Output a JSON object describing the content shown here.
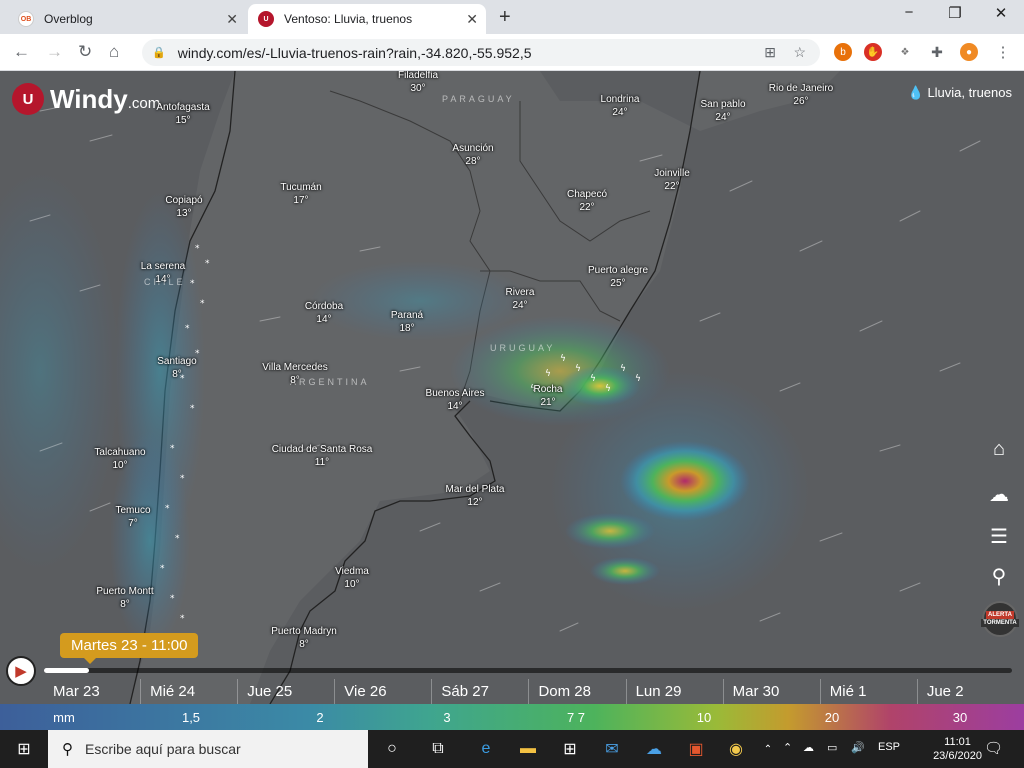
{
  "browser": {
    "tabs": [
      {
        "label": "Overblog",
        "favicon": "OB"
      },
      {
        "label": "Ventoso: Lluvia, truenos",
        "favicon": "windy-logo"
      }
    ],
    "new_tab": "+",
    "url": "windy.com/es/-Lluvia-truenos-rain?rain,-34.820,-55.952,5"
  },
  "map": {
    "logo_name": "Windy",
    "logo_domain": ".com",
    "layer_label": "Lluvia, truenos",
    "countries": [
      "PARAGUAY",
      "CHILE",
      "ARGENTINA",
      "URUGUAY"
    ],
    "cities": [
      {
        "name": "Filadelfia",
        "temp": "30°"
      },
      {
        "name": "Londrina",
        "temp": "24°"
      },
      {
        "name": "Rio de Janeiro",
        "temp": "26°"
      },
      {
        "name": "San pablo",
        "temp": "24°"
      },
      {
        "name": "Antofagasta",
        "temp": "15°"
      },
      {
        "name": "Asunción",
        "temp": "28°"
      },
      {
        "name": "Joinville",
        "temp": "22°"
      },
      {
        "name": "Tucumán",
        "temp": "17°"
      },
      {
        "name": "Chapecó",
        "temp": "22°"
      },
      {
        "name": "Copiapó",
        "temp": "13°"
      },
      {
        "name": "La serena",
        "temp": "14°"
      },
      {
        "name": "Puerto alegre",
        "temp": "25°"
      },
      {
        "name": "Rivera",
        "temp": "24°"
      },
      {
        "name": "Córdoba",
        "temp": "14°"
      },
      {
        "name": "Paraná",
        "temp": "18°"
      },
      {
        "name": "Santiago",
        "temp": "8°"
      },
      {
        "name": "Villa Mercedes",
        "temp": "8°"
      },
      {
        "name": "Rocha",
        "temp": "21°"
      },
      {
        "name": "Buenos Aires",
        "temp": "14°"
      },
      {
        "name": "Talcahuano",
        "temp": "10°"
      },
      {
        "name": "Ciudad de Santa Rosa",
        "temp": "11°"
      },
      {
        "name": "Mar del Plata",
        "temp": "12°"
      },
      {
        "name": "Temuco",
        "temp": "7°"
      },
      {
        "name": "Viedma",
        "temp": "10°"
      },
      {
        "name": "Puerto Montt",
        "temp": "8°"
      },
      {
        "name": "Puerto Madryn",
        "temp": "8°"
      }
    ],
    "side_icons": [
      "home-icon",
      "thunderstorm-icon",
      "menu-icon",
      "search-icon"
    ],
    "alert_label": "ALERTA",
    "alert_sublabel": "TORMENTA"
  },
  "timeline": {
    "current": "Martes 23 - 11:00",
    "progress": 0.046,
    "days": [
      "Mar 23",
      "Mié 24",
      "Jue 25",
      "Vie 26",
      "Sáb 27",
      "Dom 28",
      "Lun 29",
      "Mar 30",
      "Mié 1",
      "Jue 2"
    ]
  },
  "legend": {
    "unit": "mm",
    "values": [
      "1,5",
      "2",
      "3",
      "7 7",
      "10",
      "20",
      "30"
    ]
  },
  "taskbar": {
    "search_placeholder": "Escribe aquí para buscar",
    "language": "ESP",
    "time": "11:01",
    "date": "23/6/2020"
  }
}
